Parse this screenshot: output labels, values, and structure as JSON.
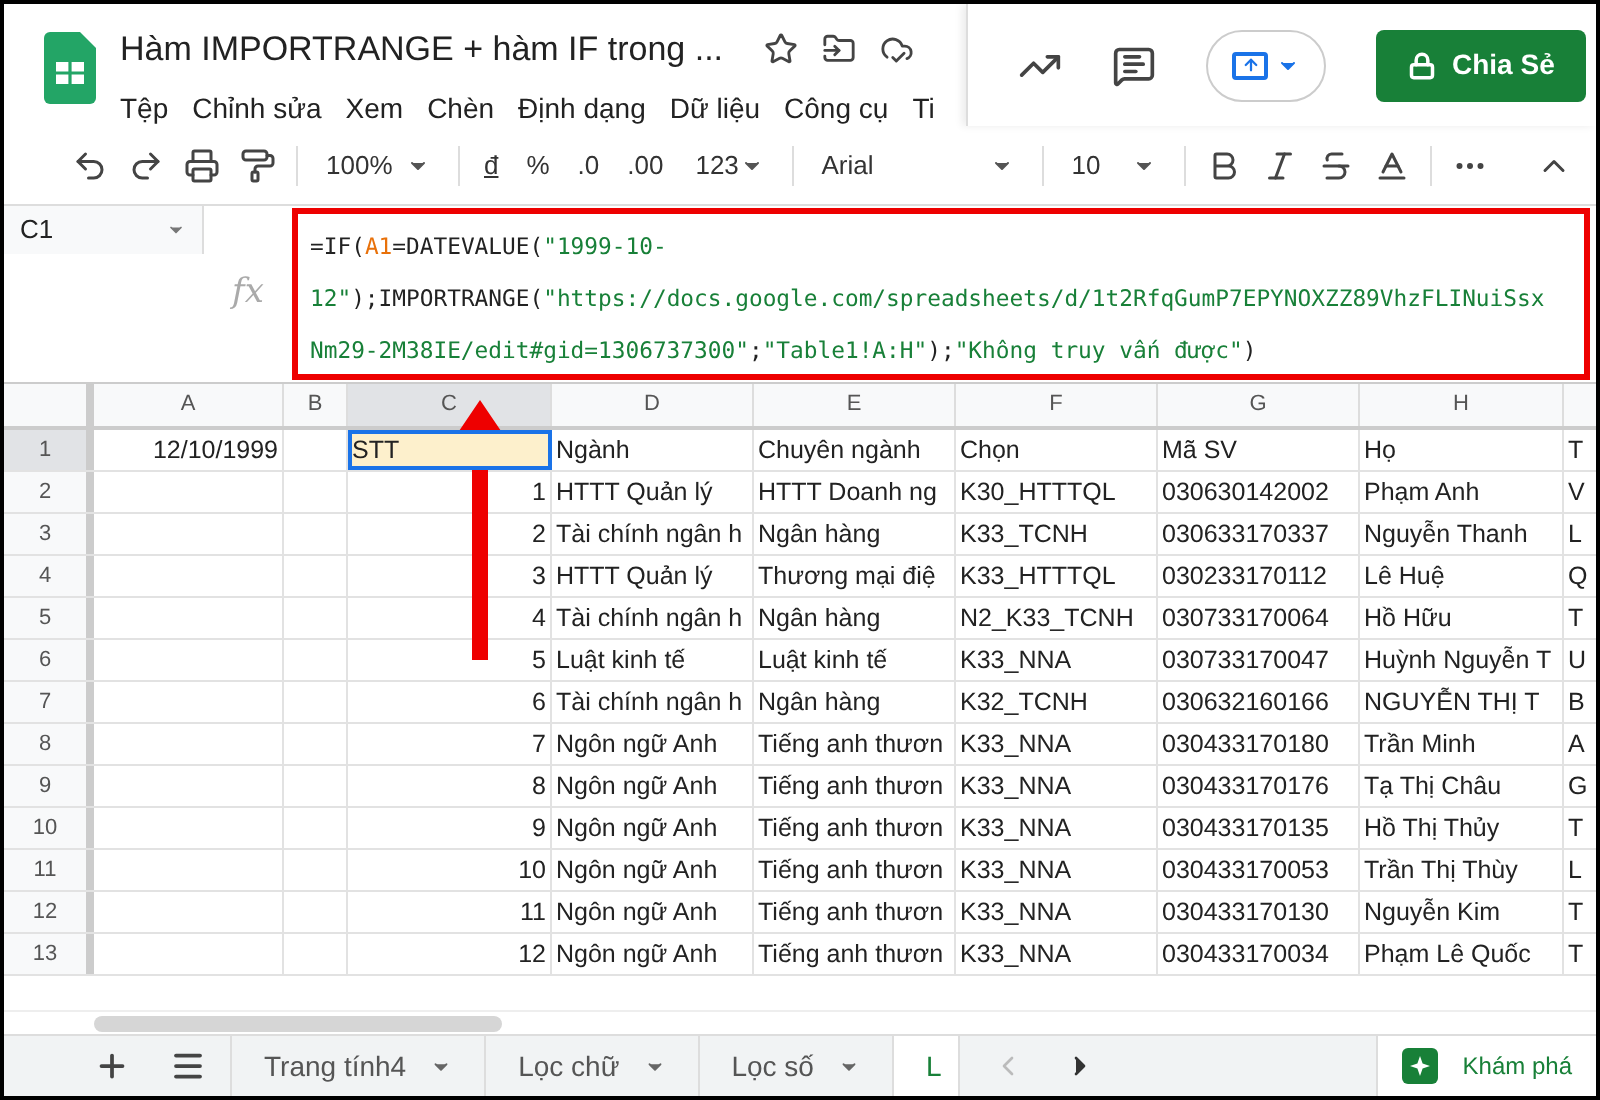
{
  "title_bar": {
    "title": "Hàm IMPORTRANGE + hàm IF trong ...",
    "menu": [
      "Tệp",
      "Chỉnh sửa",
      "Xem",
      "Chèn",
      "Định dạng",
      "Dữ liệu",
      "Công cụ",
      "Ti"
    ],
    "share_button": "Chia Sẻ"
  },
  "toolbar": {
    "zoom": "100%",
    "format_buttons": [
      "đ",
      "%",
      ".0",
      ".00"
    ],
    "number_format": "123",
    "font": "Arial",
    "font_size": "10"
  },
  "formula_bar": {
    "name_box": "C1",
    "fx_label": "fx",
    "lines": [
      [
        {
          "kind": "plain",
          "text": "=IF("
        },
        {
          "kind": "ref",
          "text": "A1"
        },
        {
          "kind": "plain",
          "text": "=DATEVALUE("
        },
        {
          "kind": "string",
          "text": "\"1999-10-"
        }
      ],
      [
        {
          "kind": "string",
          "text": "12\""
        },
        {
          "kind": "plain",
          "text": ");IMPORTRANGE("
        },
        {
          "kind": "string",
          "text": "\"https://docs.google.com/spreadsheets/d/1t2RfqGumP7EPYNOXZZ89VhzFLINuiSsx"
        }
      ],
      [
        {
          "kind": "string",
          "text": "Nm29-2M38IE/edit#gid=1306737300\""
        },
        {
          "kind": "plain",
          "text": ";"
        },
        {
          "kind": "string",
          "text": "\"Table1!A:H\""
        },
        {
          "kind": "plain",
          "text": ");"
        },
        {
          "kind": "string",
          "text": "\"Không truy vấn được\""
        },
        {
          "kind": "plain",
          "text": ")"
        }
      ]
    ]
  },
  "grid": {
    "columns": [
      {
        "label": "A",
        "selected": false
      },
      {
        "label": "B",
        "selected": false
      },
      {
        "label": "C",
        "selected": true
      },
      {
        "label": "D",
        "selected": false
      },
      {
        "label": "E",
        "selected": false
      },
      {
        "label": "F",
        "selected": false
      },
      {
        "label": "G",
        "selected": false
      },
      {
        "label": "H",
        "selected": false
      },
      {}
    ],
    "rows": [
      {
        "number": "1",
        "selected": true,
        "cells": [
          "12/10/1999",
          "",
          "STT",
          "Ngành",
          "Chuyên ngành",
          "Chọn",
          "Mã SV",
          "Họ",
          "T"
        ]
      },
      {
        "number": "2",
        "selected": false,
        "cells": [
          "",
          "",
          "1",
          "HTTT Quản lý",
          "HTTT Doanh ng",
          "K30_HTTTQL",
          "030630142002",
          "Phạm Anh",
          "V"
        ]
      },
      {
        "number": "3",
        "selected": false,
        "cells": [
          "",
          "",
          "2",
          "Tài chính ngân h",
          "Ngân hàng",
          "K33_TCNH",
          "030633170337",
          "Nguyễn Thanh",
          "L"
        ]
      },
      {
        "number": "4",
        "selected": false,
        "cells": [
          "",
          "",
          "3",
          "HTTT Quản lý",
          "Thương mại điệ",
          "K33_HTTTQL",
          "030233170112",
          "Lê Huệ",
          "Q"
        ]
      },
      {
        "number": "5",
        "selected": false,
        "cells": [
          "",
          "",
          "4",
          "Tài chính ngân h",
          "Ngân hàng",
          "N2_K33_TCNH",
          "030733170064",
          "Hồ Hữu",
          "T"
        ]
      },
      {
        "number": "6",
        "selected": false,
        "cells": [
          "",
          "",
          "5",
          "Luật kinh tế",
          "Luật kinh tế",
          "K33_NNA",
          "030733170047",
          "Huỳnh Nguyễn T",
          "U"
        ]
      },
      {
        "number": "7",
        "selected": false,
        "cells": [
          "",
          "",
          "6",
          "Tài chính ngân h",
          "Ngân hàng",
          "K32_TCNH",
          "030632160166",
          "NGUYỄN THỊ T",
          "B"
        ]
      },
      {
        "number": "8",
        "selected": false,
        "cells": [
          "",
          "",
          "7",
          "Ngôn ngữ Anh",
          "Tiếng anh thươn",
          "K33_NNA",
          "030433170180",
          "Trần Minh",
          "A"
        ]
      },
      {
        "number": "9",
        "selected": false,
        "cells": [
          "",
          "",
          "8",
          "Ngôn ngữ Anh",
          "Tiếng anh thươn",
          "K33_NNA",
          "030433170176",
          "Tạ Thị Châu",
          "G"
        ]
      },
      {
        "number": "10",
        "selected": false,
        "cells": [
          "",
          "",
          "9",
          "Ngôn ngữ Anh",
          "Tiếng anh thươn",
          "K33_NNA",
          "030433170135",
          "Hồ Thị Thủy",
          "T"
        ]
      },
      {
        "number": "11",
        "selected": false,
        "cells": [
          "",
          "",
          "10",
          "Ngôn ngữ Anh",
          "Tiếng anh thươn",
          "K33_NNA",
          "030433170053",
          "Trần Thị Thùy",
          "L"
        ]
      },
      {
        "number": "12",
        "selected": false,
        "cells": [
          "",
          "",
          "11",
          "Ngôn ngữ Anh",
          "Tiếng anh thươn",
          "K33_NNA",
          "030433170130",
          "Nguyễn Kim",
          "T"
        ]
      },
      {
        "number": "13",
        "selected": false,
        "cells": [
          "",
          "",
          "12",
          "Ngôn ngữ Anh",
          "Tiếng anh thươn",
          "K33_NNA",
          "030433170034",
          "Phạm Lê Quốc",
          "T"
        ]
      }
    ]
  },
  "sheet_tabs": {
    "tabs": [
      {
        "label": "Trang tính4",
        "selected": false
      },
      {
        "label": "Lọc chữ",
        "selected": false
      },
      {
        "label": "Lọc số",
        "selected": false
      },
      {
        "label": "L",
        "selected": true
      }
    ],
    "explore": "Khám phá"
  }
}
